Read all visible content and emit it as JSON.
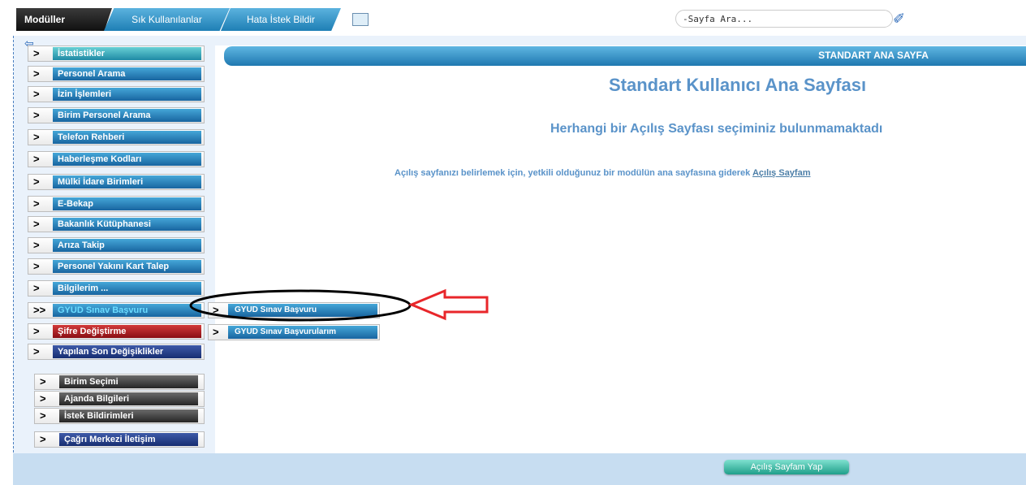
{
  "tabs": {
    "modules": "Modüller",
    "favorites": "Sık Kullanılanlar",
    "error_report": "Hata İstek Bildir"
  },
  "search": {
    "placeholder": "-Sayfa Ara..."
  },
  "menu": {
    "items": [
      "İstatistikler",
      "Personel Arama",
      "İzin İşlemleri",
      "Birim Personel Arama",
      "Telefon Rehberi",
      "Haberleşme Kodları",
      "Mülki İdare Birimleri",
      "E-Bekap",
      "Bakanlık Kütüphanesi",
      "Arıza Takip",
      "Personel Yakını Kart Talep",
      "Bilgilerim ...",
      "GYUD Sınav Başvuru",
      "Şifre Değiştirme",
      "Yapılan Son Değişiklikler"
    ],
    "bottom_items": [
      "Birim Seçimi",
      "Ajanda Bilgileri",
      "İstek Bildirimleri",
      "Çağrı Merkezi İletişim"
    ]
  },
  "submenu": {
    "items": [
      "GYUD Sınav Başvuru",
      "GYUD Sınav Başvurularım"
    ]
  },
  "content": {
    "header": "STANDART ANA SAYFA",
    "title": "Standart Kullanıcı Ana Sayfası",
    "subtitle": "Herhangi bir Açılış Sayfası seçiminiz bulunmamaktadı",
    "text": "Açılış sayfanızı belirlemek için, yetkili olduğunuz bir modülün ana sayfasına giderek ",
    "link": "Açılış Sayfam",
    "button": "Açılış Sayfam Yap"
  },
  "annotation": {
    "arrow_color": "#e8262a",
    "ellipse_color": "#000000"
  }
}
